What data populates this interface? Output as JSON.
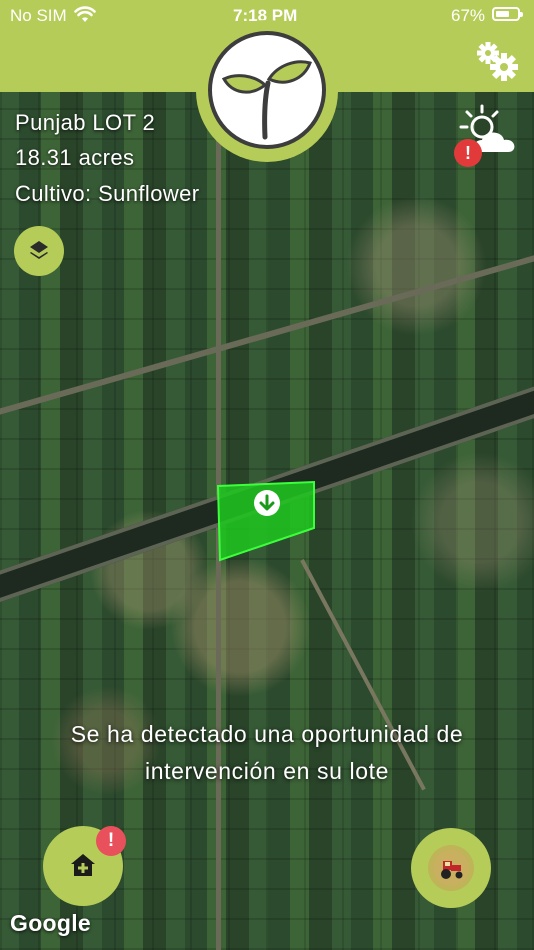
{
  "status_bar": {
    "carrier": "No SIM",
    "time": "7:18 PM",
    "battery_percent": "67%",
    "battery_level": 0.67
  },
  "lot": {
    "name": "Punjab LOT 2",
    "area": "18.31 acres",
    "crop": "Cultivo: Sunflower"
  },
  "message": {
    "line1": "Se ha detectado una oportunidad de",
    "line2": "intervención en su lote"
  },
  "alerts": {
    "weather": "!",
    "home": "!"
  },
  "map": {
    "attribution": "Google"
  },
  "colors": {
    "brand_green": "#b6cc58",
    "field_highlight": "#1ec81e",
    "alert_red": "#e23a3a"
  },
  "icons": [
    "wifi-icon",
    "battery-icon",
    "sprout-logo",
    "gear-icon",
    "layers-icon",
    "weather-sun-cloud-icon",
    "download-arrow-icon",
    "home-add-icon",
    "tractor-icon"
  ]
}
